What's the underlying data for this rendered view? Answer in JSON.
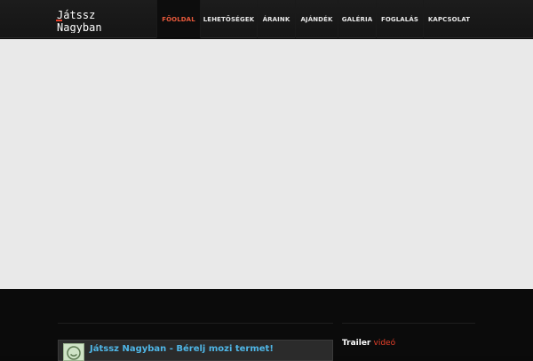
{
  "brand": {
    "logo_line1": "Játssz",
    "logo_line2": "Nagyban",
    "primary_color": "#e8402a"
  },
  "nav": {
    "items": [
      {
        "label": "FŐOLDAL",
        "active": true
      },
      {
        "label": "LEHETŐSÉGEK",
        "active": false
      },
      {
        "label": "ÁRAINK",
        "active": false
      },
      {
        "label": "AJÁNDÉK",
        "active": false
      },
      {
        "label": "GALÉRIA",
        "active": false
      },
      {
        "label": "FOGLALÁS",
        "active": false
      },
      {
        "label": "KAPCSOLAT",
        "active": false
      }
    ]
  },
  "promo": {
    "title": "Játssz Nagyban - Bérelj mozi termet!",
    "icon": "smiley-icon"
  },
  "trailer": {
    "heading_main": "Trailer",
    "heading_accent": "videó"
  }
}
